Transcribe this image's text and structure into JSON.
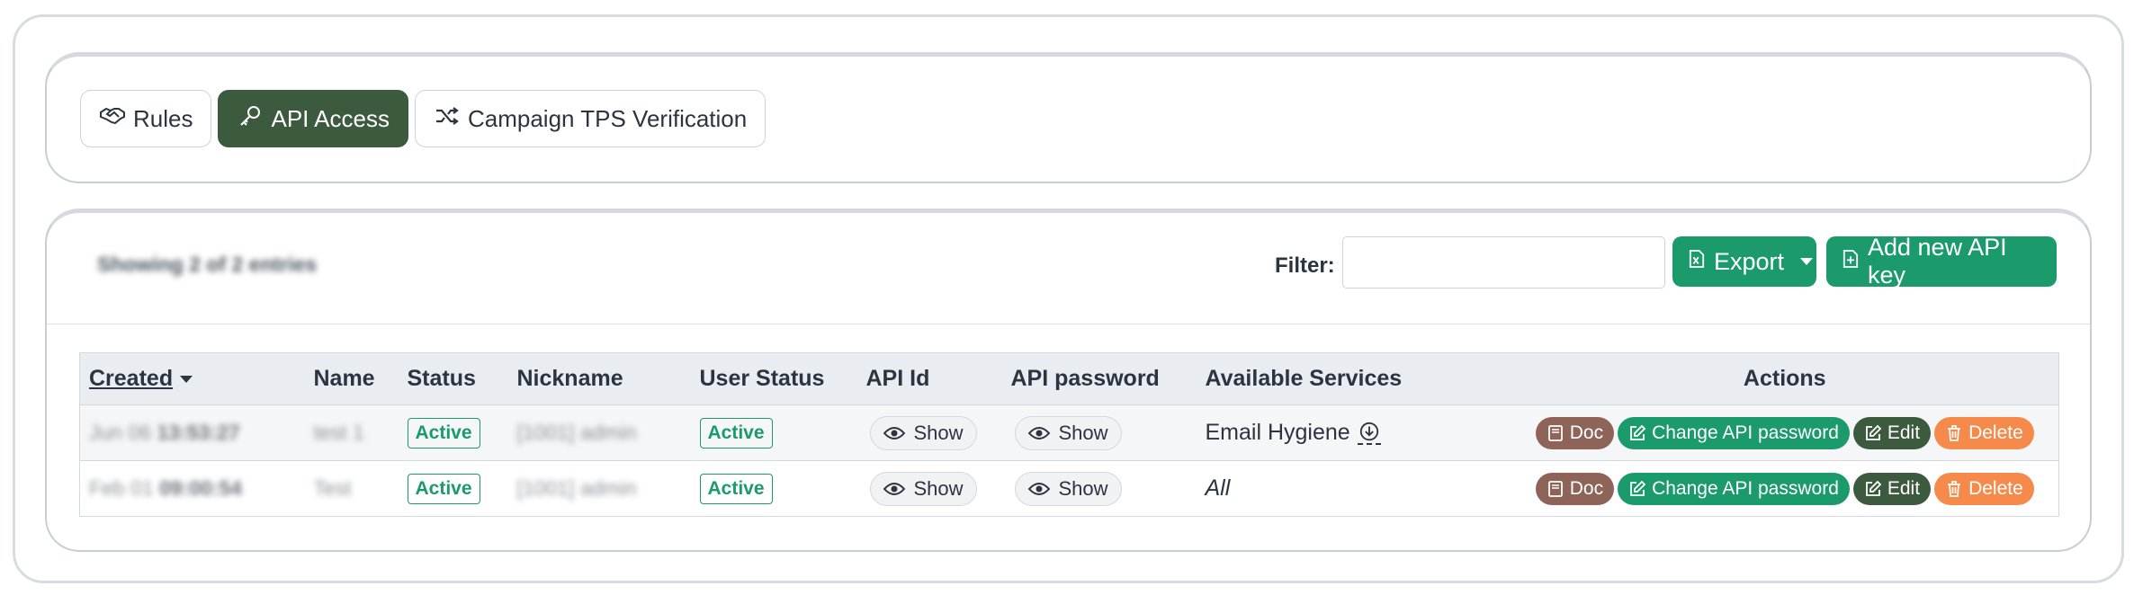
{
  "tabs": [
    {
      "label": "Rules",
      "icon": "handshake-icon",
      "active": false
    },
    {
      "label": "API Access",
      "icon": "key-icon",
      "active": true
    },
    {
      "label": "Campaign TPS Verification",
      "icon": "shuffle-icon",
      "active": false
    }
  ],
  "toolbar": {
    "showing_text": "Showing 2 of 2 entries",
    "filter_label": "Filter:",
    "filter_value": "",
    "export_label": "Export",
    "add_label": "Add new API key"
  },
  "table": {
    "headers": {
      "created": "Created",
      "name": "Name",
      "status": "Status",
      "nickname": "Nickname",
      "user_status": "User Status",
      "api_id": "API Id",
      "api_password": "API password",
      "services": "Available Services",
      "actions": "Actions"
    },
    "rows": [
      {
        "created_date": "Jun 06",
        "created_time": "13:53:27",
        "name": "test 1",
        "status": "Active",
        "nickname": "[1001] admin",
        "user_status": "Active",
        "api_id": "Show",
        "api_password": "Show",
        "services": "Email Hygiene"
      },
      {
        "created_date": "Feb 01",
        "created_time": "09:00:54",
        "name": "Test",
        "status": "Active",
        "nickname": "[1001] admin",
        "user_status": "Active",
        "api_id": "Show",
        "api_password": "Show",
        "services": "All"
      }
    ],
    "action_labels": {
      "doc": "Doc",
      "change": "Change API password",
      "edit": "Edit",
      "delete": "Delete"
    }
  },
  "colors": {
    "primary_green": "#1b9a6c",
    "dark_green": "#3c5a3e",
    "doc_brown": "#8e6459",
    "delete_orange": "#f58a4b"
  }
}
